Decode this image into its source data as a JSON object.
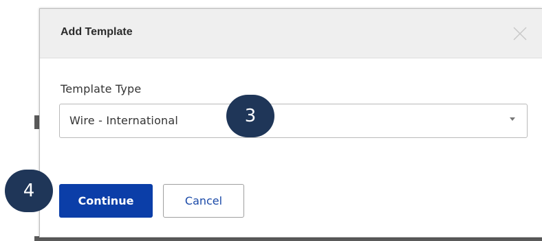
{
  "modal": {
    "title": "Add Template",
    "close_icon": "close-icon",
    "field_label": "Template Type",
    "select": {
      "value": "Wire - International",
      "caret_icon": "chevron-down-icon"
    },
    "buttons": {
      "continue_label": "Continue",
      "cancel_label": "Cancel"
    }
  },
  "callouts": {
    "step_3": "3",
    "step_4": "4"
  },
  "colors": {
    "primary_button": "#0b3ea8",
    "cancel_text": "#1b4aa8",
    "callout_bg": "#1f3658",
    "header_bg": "#efefef"
  }
}
